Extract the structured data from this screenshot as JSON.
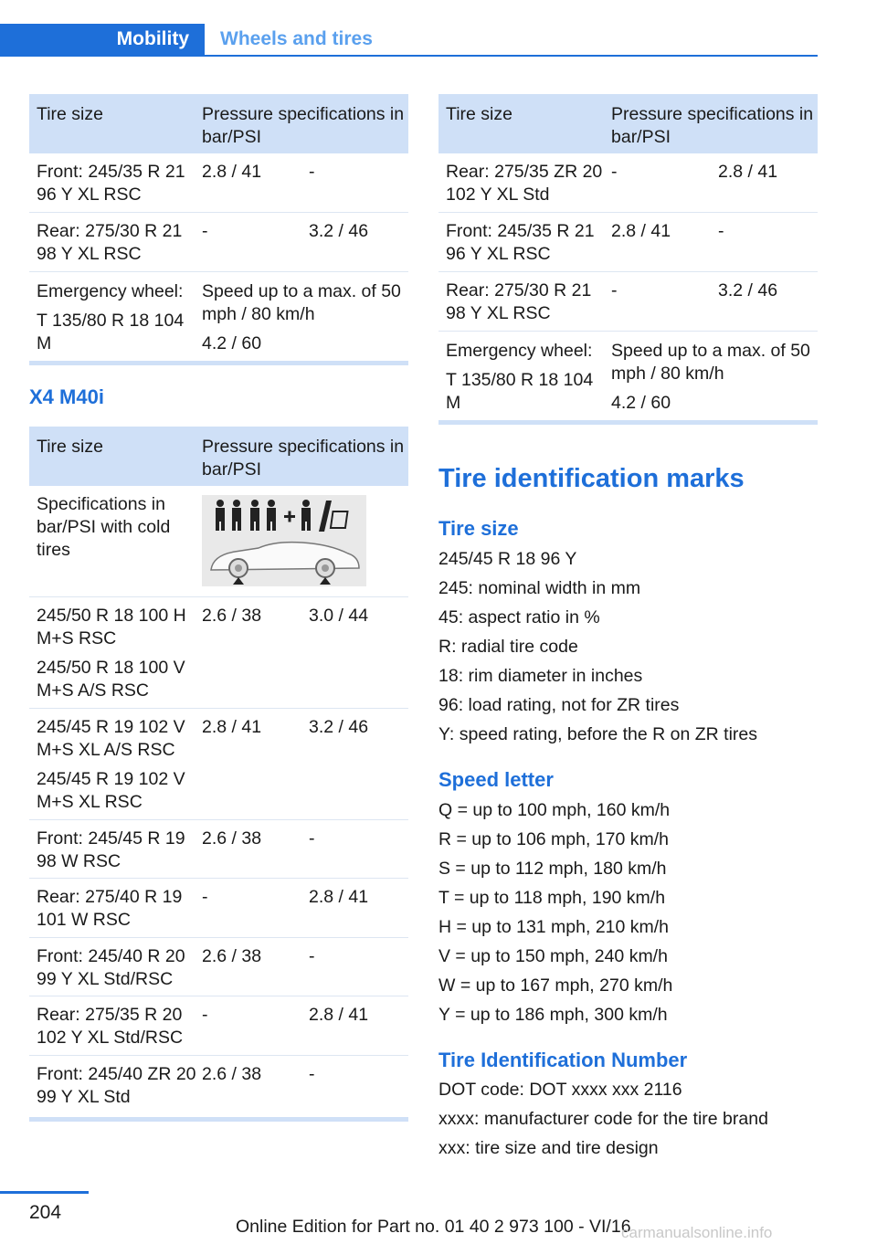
{
  "header": {
    "section": "Mobility",
    "subsection": "Wheels and tires"
  },
  "left_table_top": {
    "head": {
      "col1": "Tire size",
      "col2": "Pressure specifications in bar/PSI"
    },
    "rows": [
      {
        "size": "Front: 245/35 R 21 96 Y XL RSC",
        "v1": "2.8 / 41",
        "v2": "-"
      },
      {
        "size": "Rear: 275/30 R 21 98 Y XL RSC",
        "v1": "-",
        "v2": "3.2 / 46"
      }
    ],
    "emergency": {
      "label": "Emergency wheel:",
      "size": "T 135/80 R 18 104 M",
      "note": "Speed up to a max. of 50 mph / 80 km/h",
      "pressure": "4.2 / 60"
    }
  },
  "x4_title": "X4 M40i",
  "x4_table": {
    "head": {
      "col1": "Tire size",
      "col2": "Pressure specifications in bar/PSI"
    },
    "spec_row": "Specifications in bar/PSI with cold tires",
    "rows": [
      {
        "size_a": "245/50 R 18 100 H M+S RSC",
        "size_b": "245/50 R 18 100 V M+S A/S RSC",
        "v1": "2.6 / 38",
        "v2": "3.0 / 44"
      },
      {
        "size_a": "245/45 R 19 102 V M+S XL A/S RSC",
        "size_b": "245/45 R 19 102 V M+S XL RSC",
        "v1": "2.8 / 41",
        "v2": "3.2 / 46"
      },
      {
        "size": "Front: 245/45 R 19 98 W RSC",
        "v1": "2.6 / 38",
        "v2": "-"
      },
      {
        "size": "Rear: 275/40 R 19 101 W RSC",
        "v1": "-",
        "v2": "2.8 / 41"
      },
      {
        "size": "Front: 245/40 R 20 99 Y XL Std/RSC",
        "v1": "2.6 / 38",
        "v2": "-"
      },
      {
        "size": "Rear: 275/35 R 20 102 Y XL Std/RSC",
        "v1": "-",
        "v2": "2.8 / 41"
      },
      {
        "size": "Front: 245/40 ZR 20 99 Y XL Std",
        "v1": "2.6 / 38",
        "v2": "-"
      }
    ]
  },
  "right_table": {
    "head": {
      "col1": "Tire size",
      "col2": "Pressure specifications in bar/PSI"
    },
    "rows": [
      {
        "size": "Rear: 275/35 ZR 20 102 Y XL Std",
        "v1": "-",
        "v2": "2.8 / 41"
      },
      {
        "size": "Front: 245/35 R 21 96 Y XL RSC",
        "v1": "2.8 / 41",
        "v2": "-"
      },
      {
        "size": "Rear: 275/30 R 21 98 Y XL RSC",
        "v1": "-",
        "v2": "3.2 / 46"
      }
    ],
    "emergency": {
      "label": "Emergency wheel:",
      "size": "T 135/80 R 18 104 M",
      "note": "Speed up to a max. of 50 mph / 80 km/h",
      "pressure": "4.2 / 60"
    }
  },
  "marks": {
    "title": "Tire identification marks",
    "tire_size": {
      "title": "Tire size",
      "lines": [
        "245/45 R 18 96 Y",
        "245: nominal width in mm",
        "45: aspect ratio in %",
        "R: radial tire code",
        "18: rim diameter in inches",
        "96: load rating, not for ZR tires",
        "Y: speed rating, before the R on ZR tires"
      ]
    },
    "speed_letter": {
      "title": "Speed letter",
      "lines": [
        "Q = up to 100 mph, 160 km/h",
        "R = up to 106 mph, 170 km/h",
        "S = up to 112 mph, 180 km/h",
        "T = up to 118 mph, 190 km/h",
        "H = up to 131 mph, 210 km/h",
        "V = up to 150 mph, 240 km/h",
        "W = up to 167 mph, 270 km/h",
        "Y = up to 186 mph, 300 km/h"
      ]
    },
    "tin": {
      "title": "Tire Identification Number",
      "lines": [
        "DOT code: DOT xxxx xxx 2116",
        "xxxx: manufacturer code for the tire brand",
        "xxx: tire size and tire design"
      ]
    }
  },
  "footer": {
    "page": "204",
    "edition": "Online Edition for Part no. 01 40 2 973 100 - VI/16",
    "watermark": "carmanualsonline.info"
  }
}
